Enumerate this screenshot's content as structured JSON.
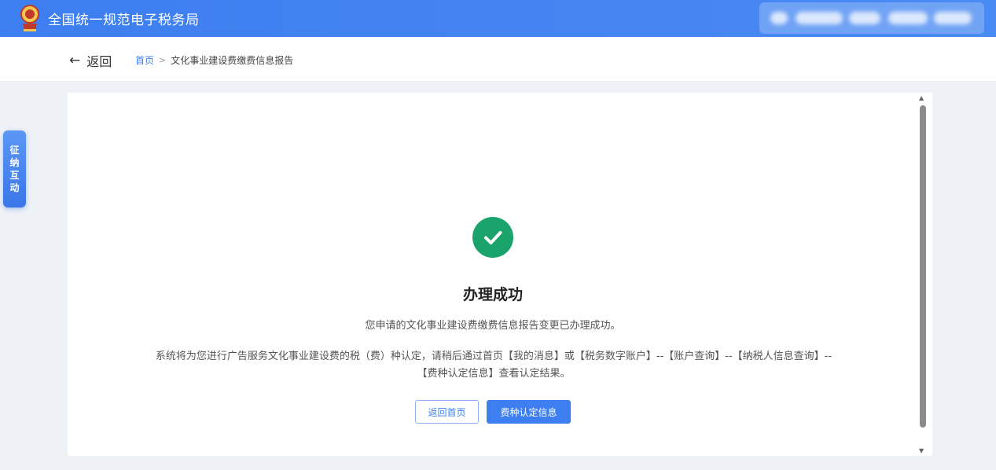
{
  "header": {
    "site_title": "全国统一规范电子税务局",
    "emblem_icon": "tax-emblem-icon",
    "brand_color": "#3d7ef0"
  },
  "breadcrumb": {
    "back_label": "返回",
    "home": "首页",
    "separator": ">",
    "current": "文化事业建设费缴费信息报告"
  },
  "side_tab": {
    "label_chars": [
      "征",
      "纳",
      "互",
      "动"
    ]
  },
  "result": {
    "icon": "success-check-icon",
    "title": "办理成功",
    "message": "您申请的文化事业建设费缴费信息报告变更已办理成功。",
    "detail_line1": "系统将为您进行广告服务文化事业建设费的税（费）种认定，请稍后通过首页【我的消息】或【税务数字账户】--【账户查询】--【纳税人信息查询】--",
    "detail_line2": "【费种认定信息】查看认定结果。",
    "success_color": "#1aa36b"
  },
  "buttons": {
    "home_label": "返回首页",
    "info_label": "费种认定信息"
  }
}
